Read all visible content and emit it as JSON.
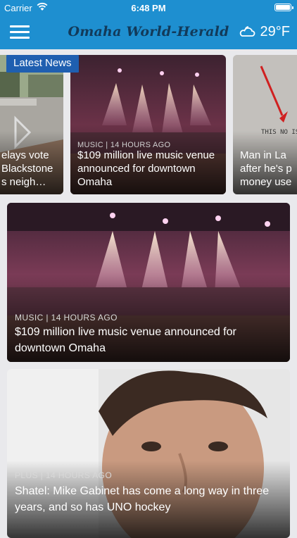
{
  "status_bar": {
    "carrier": "Carrier",
    "time": "6:48 PM"
  },
  "nav": {
    "logo": "Omaha World-Herald",
    "temperature": "29°F",
    "weather_icon": "cloud-moon-icon"
  },
  "carousel": {
    "badge": "Latest News",
    "items": [
      {
        "category": "",
        "title": "elays vote Blackstone s neigh…"
      },
      {
        "category": "MUSIC | 14 HOURS AGO",
        "title": "$109 million live music venue announced for downtown Omaha"
      },
      {
        "category": "",
        "title": "Man in La after he's p money use",
        "image_text": "THIS NO IS TO BE USED"
      }
    ]
  },
  "stories": [
    {
      "category": "MUSIC | 14 HOURS AGO",
      "title": "$109 million live music venue announced for downtown Omaha"
    },
    {
      "category": "PLUS | 14 HOURS AGO",
      "title": "Shatel: Mike Gabinet has come a long way in three years, and so has UNO hockey"
    }
  ]
}
